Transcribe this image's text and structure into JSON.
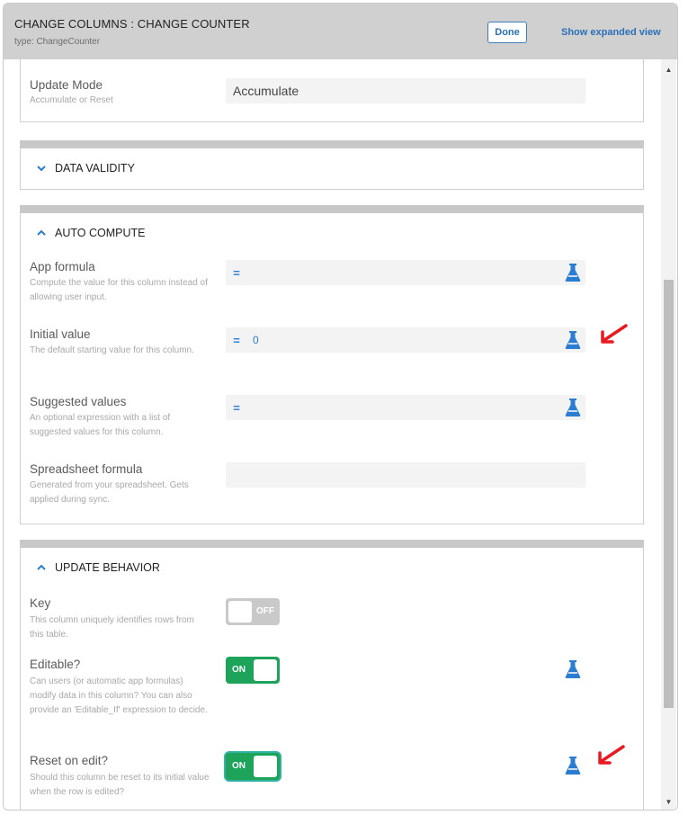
{
  "header": {
    "title": "CHANGE COLUMNS : CHANGE COUNTER",
    "subtitle": "type: ChangeCounter",
    "done_label": "Done",
    "expand_label": "Show expanded view"
  },
  "update_mode": {
    "label": "Update Mode",
    "description": "Accumulate or Reset",
    "value": "Accumulate"
  },
  "sections": {
    "data_validity": "DATA VALIDITY",
    "auto_compute": "AUTO COMPUTE",
    "update_behavior": "UPDATE BEHAVIOR"
  },
  "auto_compute": {
    "app_formula": {
      "label": "App formula",
      "description": "Compute the value for this column instead of allowing user input.",
      "eq": "=",
      "value": ""
    },
    "initial_value": {
      "label": "Initial value",
      "description": "The default starting value for this column.",
      "eq": "=",
      "value": "0"
    },
    "suggested_values": {
      "label": "Suggested values",
      "description": "An optional expression with a list of suggested values for this column.",
      "eq": "=",
      "value": ""
    },
    "spreadsheet_formula": {
      "label": "Spreadsheet formula",
      "description": "Generated from your spreadsheet. Gets applied during sync.",
      "value": ""
    }
  },
  "update_behavior": {
    "key": {
      "label": "Key",
      "description": "This column uniquely identifies rows from this table.",
      "toggle": "OFF"
    },
    "editable": {
      "label": "Editable?",
      "description": "Can users (or automatic app formulas) modify data in this column? You can also provide an 'Editable_If' expression to decide.",
      "toggle": "ON"
    },
    "reset_on_edit": {
      "label": "Reset on edit?",
      "description": "Should this column be reset to its initial value when the row is edited?",
      "toggle": "ON"
    }
  },
  "colors": {
    "accent": "#2a7dd1",
    "toggle_on": "#1ea35b",
    "toggle_off": "#c9c9c9",
    "annotation": "#e8191f"
  },
  "icons": {
    "flask": "flask-icon",
    "chevron_down": "chevron-down-icon",
    "chevron_up": "chevron-up-icon",
    "annotation_arrow": "red-arrow-annotation"
  }
}
